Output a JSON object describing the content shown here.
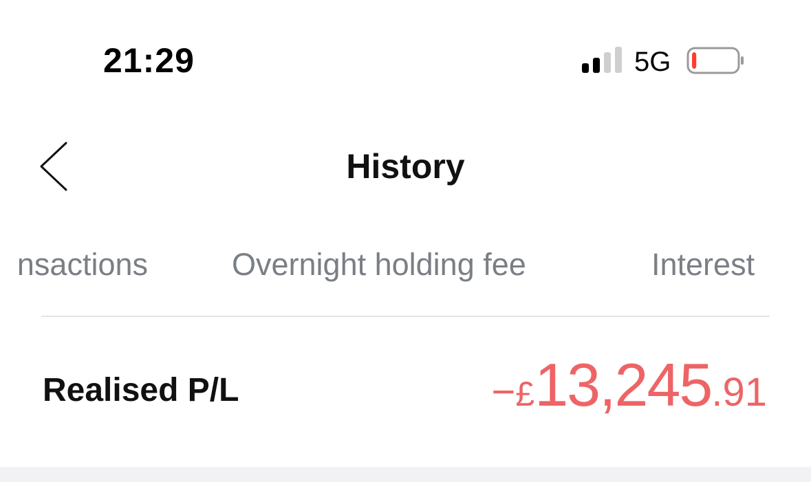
{
  "status_bar": {
    "time": "21:29",
    "network": "5G",
    "signal_bars_active": 2,
    "signal_bars_total": 4,
    "battery_level": 0.1,
    "battery_low_color": "#ff3b30"
  },
  "nav": {
    "title": "History",
    "back_icon": "chevron-left-icon"
  },
  "tabs": [
    {
      "label": "nsactions"
    },
    {
      "label": "Overnight holding fee"
    },
    {
      "label": "Interest"
    }
  ],
  "summary": {
    "label": "Realised P/L",
    "amount_sign": "−",
    "amount_currency": "£",
    "amount_integer": "13,245",
    "amount_decimal": ".91",
    "amount_color": "#ee6466"
  }
}
